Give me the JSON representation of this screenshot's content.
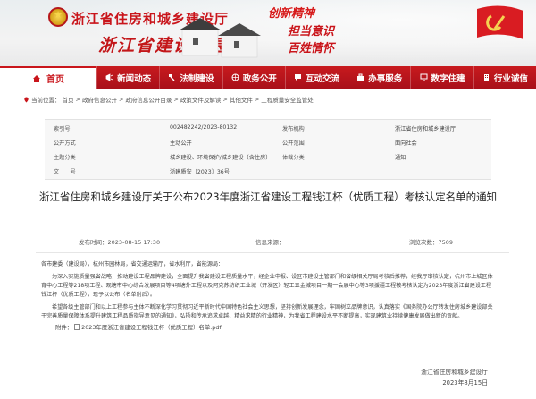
{
  "header": {
    "site_name": "浙江省住房和城乡建设厅",
    "site_subtitle": "浙江省建设信息港",
    "slogans": [
      "创新精神",
      "担当意识",
      "百姓情怀"
    ]
  },
  "nav": {
    "home": "首页",
    "items": [
      "新闻动态",
      "法制建设",
      "政务公开",
      "互动交流",
      "办事服务",
      "数字住建",
      "行业诚信"
    ]
  },
  "breadcrumb": {
    "prefix": "当前位置：",
    "items": [
      "首页",
      "政府信息公开",
      "政府信息公开目录",
      "政策文件及解读",
      "其他文件",
      "工程质量安全监管处"
    ],
    "separator": ">"
  },
  "info_table": {
    "rows": [
      {
        "l1": "索引号",
        "v1": "002482242/2023-80132",
        "l2": "发布机构",
        "v2": "浙江省住房和城乡建设厅"
      },
      {
        "l1": "公开方式",
        "v1": "主动公开",
        "l2": "公开范围",
        "v2": "面向社会"
      },
      {
        "l1": "主题分类",
        "v1": "城乡建设、环境保护/城乡建设（含住房）",
        "l2": "体裁分类",
        "v2": "通知"
      },
      {
        "l1": "文　　号",
        "v1": "浙建质安〔2023〕36号",
        "l2": "",
        "v2": ""
      }
    ]
  },
  "document": {
    "title": "浙江省住房和城乡建设厅关于公布2023年度浙江省建设工程钱江杯（优质工程）考核认定名单的通知",
    "publish_label": "发布时间：",
    "publish_time": "2023-08-15 17:30",
    "source_label": "信息来源：",
    "source_value": "",
    "views_label": "浏览次数：",
    "views_value": "7509",
    "paragraphs": [
      "各市建委（建设局），杭州市园林局，省交通运输厅，省水利厅，省能源局：",
      "为深入实施质量强省战略，推动建设工程品牌建设，全面提升我省建设工程质量水平，经企业申报、设区市建设主管部门和省级相关厅局考核后推荐，经我厅审核认定，杭州市上城区体育中心工程等218项工程、观塘市中心综合发展项目等4项塘外工程以及阿克苏纺织工业城（开发区）轻工五金城项目一期一会展中心等3项援疆工程被考核认定为2023年度浙江省建设工程钱江杯（优质工程），现予以公布（名单附后）。",
      "希望各级主管部门和以上工程参与主体不断深化学习贯彻习近平新时代中国特色社会主义思想，坚持创新发展理念，牢固树立品牌意识，认真落实《国务院办公厅转发住房城乡建设部关于完善质量保障体系提升建筑工程品质指导意见的通知》，弘扬和传承追求卓越、精益求精的行业精神，为我省工程建设水平不断提高，实现建筑业持续健康发展做出新的贡献。"
    ],
    "attachment_label": "附件：",
    "attachment_name": "2023年度浙江省建设工程钱江杯（优质工程）名单.pdf",
    "signature_org": "浙江省住房和城乡建设厅",
    "signature_date": "2023年8月15日"
  },
  "colors": {
    "brand_red": "#c9151b",
    "nav_dark_red": "#a9101a"
  }
}
